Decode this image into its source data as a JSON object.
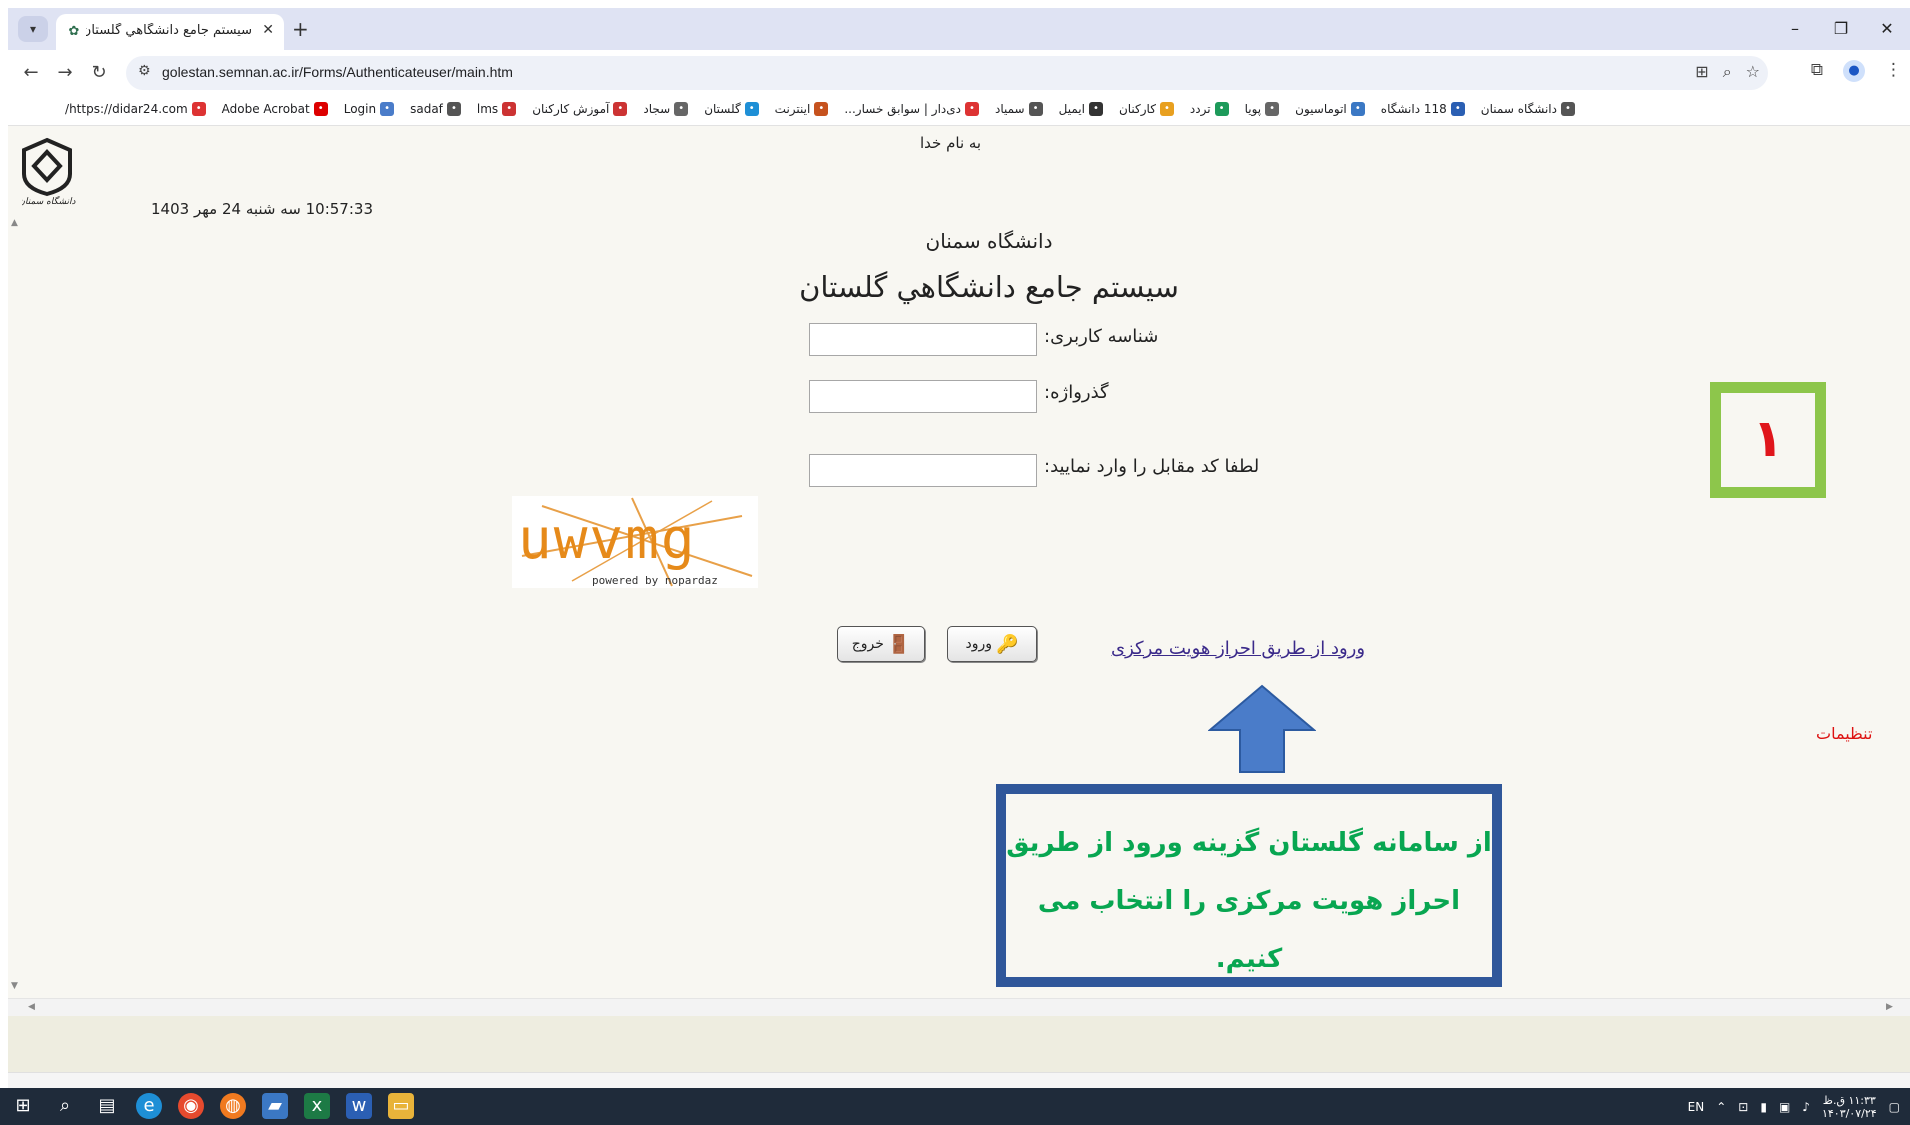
{
  "browser": {
    "tab_title": "سیستم جامع دانشگاهي گلستان",
    "url": "golestan.semnan.ac.ir/Forms/Authenticateuser/main.htm",
    "bookmarks": [
      "دانشگاه سمنان",
      "118 دانشگاه",
      "اتوماسیون",
      "پویا",
      "تردد",
      "کارکنان",
      "ایمیل",
      "سمیاد",
      "دی‌دار | سوابق خسار...",
      "اینترنت",
      "گلستان",
      "سجاد",
      "آموزش کارکنان",
      "lms",
      "sadaf",
      "Login",
      "Adobe Acrobat",
      "https://didar24.com/"
    ]
  },
  "page": {
    "bismillah": "به نام خدا",
    "datetime": "10:57:33 سه شنبه 24 مهر 1403",
    "university": "دانشگاه سمنان",
    "system_title": "سیستم جامع دانشگاهي گلستان",
    "username_label": "شناسه کاربری:",
    "password_label": "گذرواژه:",
    "captcha_label": "لطفا کد مقابل را وارد نمایید:",
    "captcha_text": "uwvmg",
    "captcha_powered": "powered by nopardaz",
    "login_button": "ورود",
    "exit_button": "خروج",
    "sso_link": "ورود از طریق احراز هویت مرکزی",
    "settings_link": "تنظیمات",
    "logo_caption": "دانشگاه سمنان"
  },
  "annotations": {
    "step_number": "۱",
    "instruction": "از سامانه گلستان گزینه ورود از طریق احراز هویت مرکزی را انتخاب می کنیم.",
    "colors": {
      "badge_border": "#8dc64b",
      "badge_text": "#e0161c",
      "box_border": "#30579a",
      "box_text": "#08a651",
      "arrow": "#4a7cc9"
    }
  },
  "taskbar": {
    "lang": "EN",
    "time": "۱۱:۳۳ ق.ظ",
    "date": "۱۴۰۳/۰۷/۲۴"
  }
}
